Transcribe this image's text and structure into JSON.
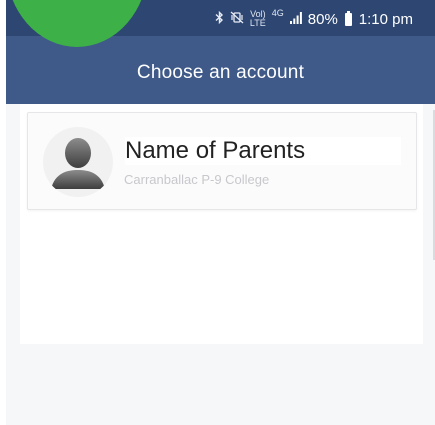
{
  "status_bar": {
    "icons": [
      "bluetooth-icon",
      "vibrate-icon",
      "volte-icon",
      "4g-icon",
      "signal-icon",
      "battery-icon"
    ],
    "volte_top": "Vol)",
    "volte_bottom": "LTE",
    "network": "4G",
    "battery_percent": "80%",
    "time": "1:10 pm"
  },
  "header": {
    "title": "Choose an account"
  },
  "accounts": [
    {
      "name": "Name of Parents",
      "school": "Carranballac P-9 College"
    }
  ],
  "colors": {
    "header": "#3f5a88",
    "status_bar": "#2e4772",
    "badge": "#3db148"
  }
}
